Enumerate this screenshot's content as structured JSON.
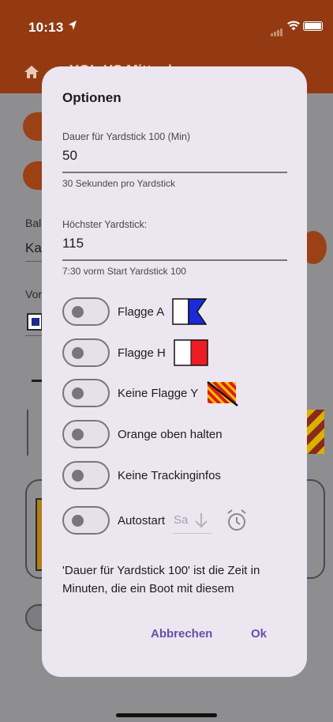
{
  "status_bar": {
    "time": "10:13"
  },
  "app_bar": {
    "title_partial": "YOL-YS Mitt...der...",
    "home_icon": "home-icon"
  },
  "background": {
    "label_1": "Bal",
    "value_1": "Ka",
    "label_2": "Vor"
  },
  "dialog": {
    "title": "Optionen",
    "field_duration": {
      "label": "Dauer für Yardstick 100 (Min)",
      "value": "50",
      "helper": "30 Sekunden pro Yardstick"
    },
    "field_max_yardstick": {
      "label": "Höchster Yardstick:",
      "value": "115",
      "helper": "7:30 vorm Start Yardstick 100"
    },
    "toggles": [
      {
        "label": "Flagge A",
        "on": false,
        "icon": "flag-a-icon"
      },
      {
        "label": "Flagge H",
        "on": false,
        "icon": "flag-h-icon"
      },
      {
        "label": "Keine Flagge Y",
        "on": false,
        "icon": "flag-y-crossed-icon"
      },
      {
        "label": "Orange oben halten",
        "on": false
      },
      {
        "label": "Keine Trackinginfos",
        "on": false
      },
      {
        "label": "Autostart",
        "on": false
      }
    ],
    "autostart_dropdown": {
      "value": "Sa",
      "icon": "arrow-down-icon"
    },
    "alarm_icon": "alarm-clock-icon",
    "description": "'Dauer für Yardstick 100' ist die Zeit in Minuten, die ein Boot mit diesem",
    "cancel_label": "Abbrechen",
    "ok_label": "Ok"
  },
  "colors": {
    "app_bar": "#933a12",
    "dialog_bg": "#ece6f1",
    "accent": "#6750a4",
    "flag_blue": "#1a2ad6",
    "flag_red": "#ee1c24",
    "flag_yellow": "#f5c400"
  }
}
